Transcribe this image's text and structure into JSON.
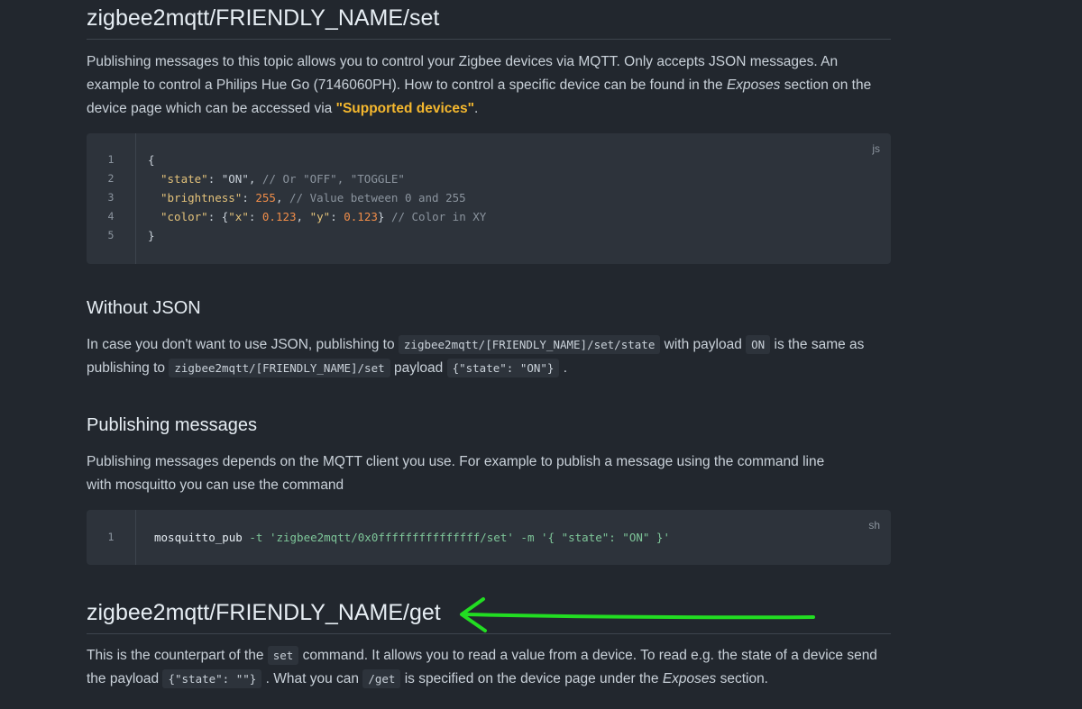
{
  "section_set": {
    "heading": "zigbee2mqtt/FRIENDLY_NAME/set",
    "p_part1": "Publishing messages to this topic allows you to control your Zigbee devices via MQTT. Only accepts JSON messages. An example to control a Philips Hue Go (7146060PH). How to control a specific device can be found in the ",
    "p_exposes": "Exposes",
    "p_part2": " section on the device page which can be accessed via ",
    "p_link": "\"Supported devices\"",
    "p_part3": ".",
    "code": {
      "lang": "js",
      "line_numbers": [
        "1",
        "2",
        "3",
        "4",
        "5"
      ],
      "l1": "{",
      "l2_key": "\"state\"",
      "l2_colon": ": ",
      "l2_val": "\"ON\"",
      "l2_comma": ", ",
      "l2_comment": "// Or \"OFF\", \"TOGGLE\"",
      "l3_key": "\"brightness\"",
      "l3_colon": ": ",
      "l3_val": "255",
      "l3_comma": ", ",
      "l3_comment": "// Value between 0 and 255",
      "l4_key": "\"color\"",
      "l4_colon": ": {",
      "l4_xk": "\"x\"",
      "l4_c1": ": ",
      "l4_xv": "0.123",
      "l4_comma": ", ",
      "l4_yk": "\"y\"",
      "l4_c2": ": ",
      "l4_yv": "0.123",
      "l4_close": "} ",
      "l4_comment": "// Color in XY",
      "l5": "}"
    }
  },
  "section_without_json": {
    "heading": "Without JSON",
    "t1": "In case you don't want to use JSON, publishing to ",
    "c1": "zigbee2mqtt/[FRIENDLY_NAME]/set/state",
    "t2": " with payload ",
    "c2": "ON",
    "t3": " is the same as publishing to ",
    "c3": "zigbee2mqtt/[FRIENDLY_NAME]/set",
    "t4": " payload ",
    "c4": "{\"state\": \"ON\"}",
    "t5": " ."
  },
  "section_publishing": {
    "heading": "Publishing messages",
    "text": "Publishing messages depends on the MQTT client you use. For example to publish a message using the command line with mosquitto you can use the command",
    "code": {
      "lang": "sh",
      "line_number": "1",
      "cmd": "mosquitto_pub",
      "opt_t": " -t ",
      "arg_t": "'zigbee2mqtt/0x0fffffffffffffff/set'",
      "opt_m": " -m ",
      "arg_m": "'{ \"state\": \"ON\" }'"
    }
  },
  "section_get": {
    "heading": "zigbee2mqtt/FRIENDLY_NAME/get",
    "t1": "This is the counterpart of the ",
    "c1": "set",
    "t2": " command. It allows you to read a value from a device. To read e.g. the state of a device send the payload ",
    "c2": "{\"state\": \"\"}",
    "t3": " . What you can ",
    "c3": "/get",
    "t4": " is specified on the device page under the ",
    "e1": "Exposes",
    "t5": " section."
  },
  "annotation": {
    "arrow_color": "#22dd22"
  }
}
